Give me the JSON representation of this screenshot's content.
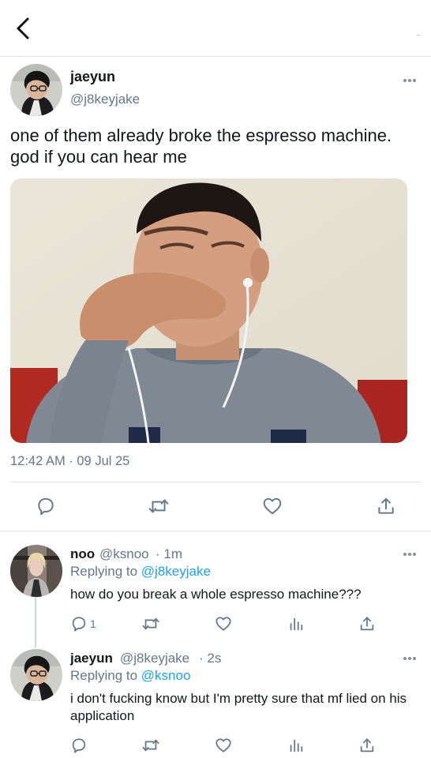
{
  "header": {
    "back_icon": "chevron-left-icon"
  },
  "tweet": {
    "name": "jaeyun",
    "handle": "@j8keyjake",
    "text": "one of them already broke the espresso machine. god if you can hear me",
    "timestamp": "12:42 AM · 09 Jul 25",
    "actions": [
      "reply-icon",
      "retweet-icon",
      "like-icon",
      "share-icon"
    ]
  },
  "replies": [
    {
      "name": "noo",
      "handle": "@ksnoo",
      "time": "· 1m",
      "replying_label": "Replying to",
      "replying_to": "@j8keyjake",
      "text": "how do you break a whole espresso machine???",
      "reply_count": "1"
    },
    {
      "name": "jaeyun",
      "handle": "@j8keyjake",
      "time": "· 2s",
      "replying_label": "Replying to",
      "replying_to": "@ksnoo",
      "text": "i don't fucking know but I'm pretty sure that mf lied on his application",
      "reply_count": ""
    }
  ],
  "colors": {
    "link": "#1da1f2",
    "muted": "#657786",
    "text": "#14171a",
    "divider": "#e1e4e6"
  }
}
